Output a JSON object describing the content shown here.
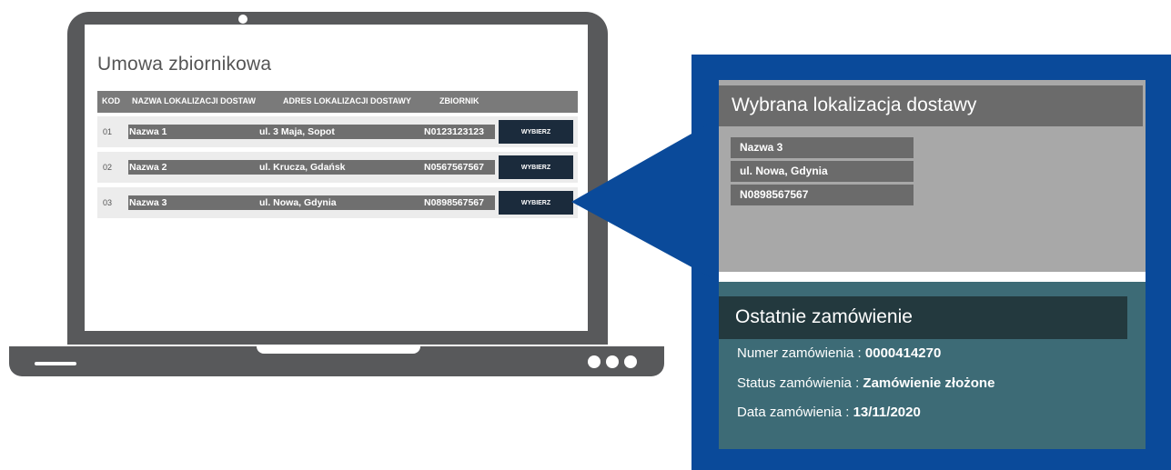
{
  "app": {
    "title": "Umowa zbiornikowa",
    "table": {
      "headers": [
        "KOD",
        "NAZWA LOKALIZACJI DOSTAW",
        "ADRES LOKALIZACJI DOSTAWY",
        "ZBIORNIK"
      ],
      "rows": [
        {
          "kod": "01",
          "name": "Nazwa 1",
          "address": "ul. 3 Maja, Sopot",
          "tank": "N0123123123",
          "button": "WYBIERZ"
        },
        {
          "kod": "02",
          "name": "Nazwa 2",
          "address": "ul. Krucza, Gdańsk",
          "tank": "N0567567567",
          "button": "WYBIERZ"
        },
        {
          "kod": "03",
          "name": "Nazwa 3",
          "address": "ul. Nowa, Gdynia",
          "tank": "N0898567567",
          "button": "WYBIERZ"
        }
      ]
    }
  },
  "selected": {
    "title": "Wybrana lokalizacja dostawy",
    "name": "Nazwa 3",
    "address": "ul. Nowa, Gdynia",
    "tank": "N0898567567"
  },
  "last_order": {
    "title": "Ostatnie zamówienie",
    "number_label": "Numer zamówienia : ",
    "number_value": "0000414270",
    "status_label": "Status zamówienia : ",
    "status_value": "Zamówienie złożone",
    "date_label": "Data zamówienia : ",
    "date_value": "13/11/2020"
  },
  "colors": {
    "device": "#58595b",
    "callout_frame": "#0a4a9a",
    "button": "#1b2b3c",
    "order_panel": "#3d6b76"
  }
}
